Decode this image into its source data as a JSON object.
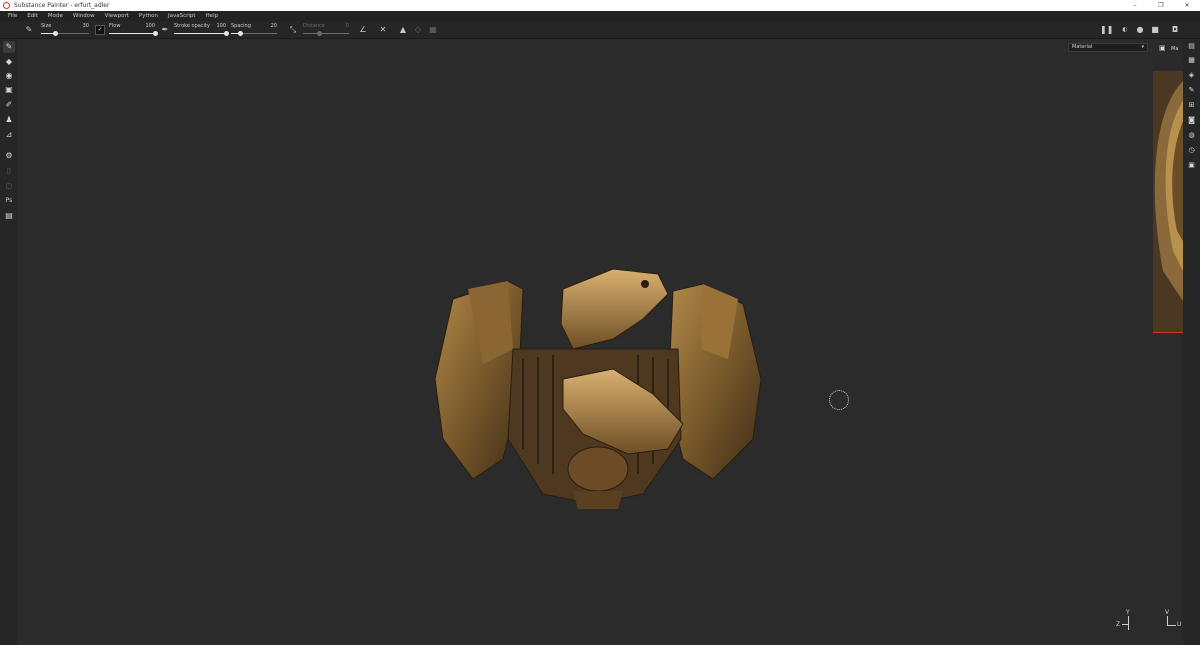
{
  "window": {
    "title": "Substance Painter - erfurt_adler",
    "minimize": "–",
    "maximize": "❐",
    "close": "✕"
  },
  "menu": [
    "File",
    "Edit",
    "Mode",
    "Window",
    "Viewport",
    "Python",
    "JavaScript",
    "Help"
  ],
  "toolbar": {
    "size": {
      "label": "Size",
      "value": "30",
      "fraction": 0.3
    },
    "flow": {
      "label": "Flow",
      "value": "100",
      "fraction": 1.0
    },
    "stroke_opacity": {
      "label": "Stroke opacity",
      "value": "100",
      "fraction": 1.0
    },
    "spacing": {
      "label": "Spacing",
      "value": "20",
      "fraction": 0.2
    },
    "distance": {
      "label": "Distance",
      "value": "0",
      "fraction": 0.35
    }
  },
  "viewport": {
    "channel": "Material",
    "axis_left": {
      "y": "Y",
      "x": "Z"
    },
    "axis_right": {
      "y": "V",
      "x": "U"
    }
  },
  "uv_preview": {
    "label": "Ma"
  },
  "colors": {
    "accent_red": "#c0392b",
    "background": "#2b2b2b",
    "panel": "#262626"
  },
  "icons": {
    "left_tools": [
      "paint-brush-icon",
      "eraser-icon",
      "projection-icon",
      "geometry-mask-icon",
      "smudge-icon",
      "clone-stamp-icon",
      "color-picker-icon",
      "settings-icon",
      "disabled-tool-icon",
      "disabled-tool-icon",
      "photoshop-icon",
      "clipboard-icon"
    ],
    "right_tools": [
      "texture-set-list-icon",
      "texture-set-settings-icon",
      "layers-icon",
      "properties-icon",
      "display-settings-icon",
      "shader-settings-icon",
      "environment-icon",
      "history-icon",
      "log-icon"
    ]
  }
}
